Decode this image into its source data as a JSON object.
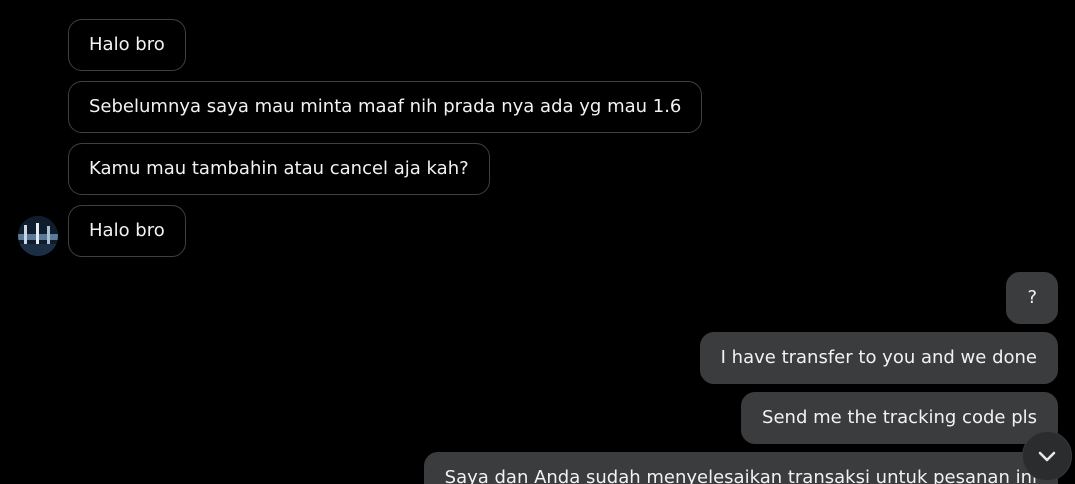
{
  "conversation": {
    "incoming": [
      {
        "text": "Halo bro"
      },
      {
        "text": "Sebelumnya saya mau minta maaf nih prada nya ada yg mau 1.6"
      },
      {
        "text": "Kamu mau tambahin atau cancel aja kah?"
      },
      {
        "text": "Halo bro"
      }
    ],
    "outgoing": [
      {
        "text": "?"
      },
      {
        "text": "I have transfer to you and we done"
      },
      {
        "text": "Send me the tracking code pls"
      },
      {
        "text": "Saya dan Anda sudah menyelesaikan transaksi untuk pesanan ini"
      }
    ]
  },
  "icons": {
    "avatar": "contact-avatar",
    "scroll_down": "chevron-down-icon"
  },
  "colors": {
    "background": "#000000",
    "incoming_border": "#3f3f3f",
    "outgoing_bubble": "#3b3c3e",
    "text": "#f2f2f2"
  }
}
